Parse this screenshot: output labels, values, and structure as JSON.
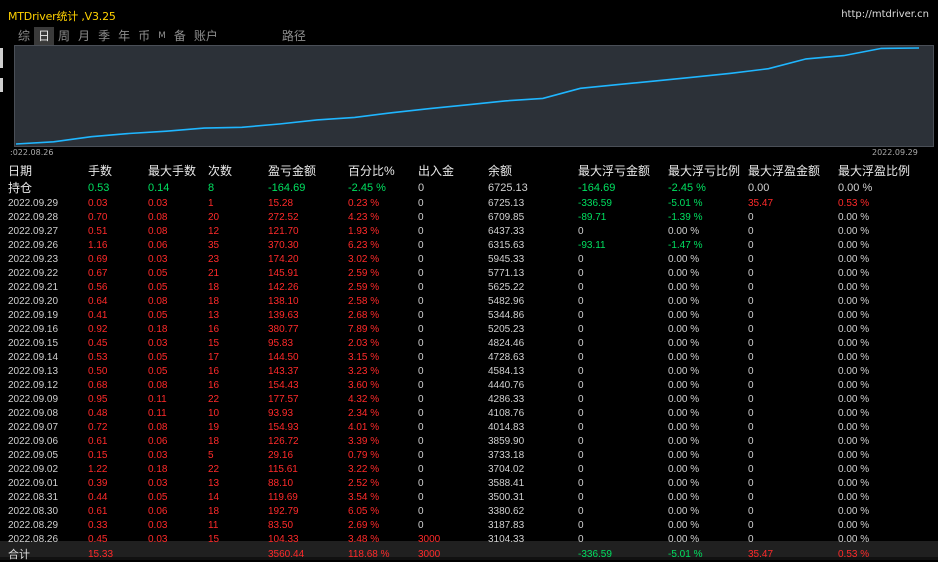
{
  "window": {
    "title": "MTDriver统计 ,V3.25",
    "url": "http://mtdriver.cn"
  },
  "tabs": [
    {
      "label": "综",
      "active": false
    },
    {
      "label": "日",
      "active": true
    },
    {
      "label": "周",
      "active": false
    },
    {
      "label": "月",
      "active": false
    },
    {
      "label": "季",
      "active": false
    },
    {
      "label": "年",
      "active": false
    },
    {
      "label": "币",
      "active": false
    },
    {
      "label": "M",
      "active": false
    },
    {
      "label": "备",
      "active": false
    },
    {
      "label": "账户",
      "active": false
    },
    {
      "label": "路径",
      "active": false
    }
  ],
  "chart_data": {
    "type": "line",
    "x_start_label": ":022.08.26",
    "x_end_label": "2022.09.29",
    "x": [
      "2022.08.26",
      "2022.08.29",
      "2022.08.30",
      "2022.08.31",
      "2022.09.01",
      "2022.09.02",
      "2022.09.05",
      "2022.09.06",
      "2022.09.07",
      "2022.09.08",
      "2022.09.09",
      "2022.09.12",
      "2022.09.13",
      "2022.09.14",
      "2022.09.15",
      "2022.09.16",
      "2022.09.19",
      "2022.09.20",
      "2022.09.21",
      "2022.09.22",
      "2022.09.23",
      "2022.09.26",
      "2022.09.27",
      "2022.09.28",
      "2022.09.29"
    ],
    "y": [
      3104.33,
      3187.83,
      3380.62,
      3500.31,
      3588.41,
      3704.02,
      3733.18,
      3859.9,
      4014.83,
      4108.76,
      4286.33,
      4440.76,
      4584.13,
      4728.63,
      4824.46,
      5205.23,
      5344.86,
      5482.96,
      5625.22,
      5771.13,
      5945.33,
      6315.63,
      6437.33,
      6709.85,
      6725.13
    ],
    "line_color": "#1fb6ff",
    "background": "#2c3138"
  },
  "table": {
    "headers": [
      "日期",
      "手数",
      "最大手数",
      "次数",
      "盈亏金额",
      "百分比%",
      "出入金",
      "余额",
      "最大浮亏金额",
      "最大浮亏比例",
      "最大浮盈金额",
      "最大浮盈比例"
    ],
    "holding": [
      "持仓",
      "0.53",
      "0.14",
      "8",
      "-164.69",
      "-2.45 %",
      "0",
      "6725.13",
      "-164.69",
      "-2.45 %",
      "0.00",
      "0.00 %"
    ],
    "rows": [
      [
        "2022.09.29",
        "0.03",
        "0.03",
        "1",
        "15.28",
        "0.23 %",
        "0",
        "6725.13",
        "-336.59",
        "-5.01 %",
        "35.47",
        "0.53 %"
      ],
      [
        "2022.09.28",
        "0.70",
        "0.08",
        "20",
        "272.52",
        "4.23 %",
        "0",
        "6709.85",
        "-89.71",
        "-1.39 %",
        "0",
        "0.00 %"
      ],
      [
        "2022.09.27",
        "0.51",
        "0.08",
        "12",
        "121.70",
        "1.93 %",
        "0",
        "6437.33",
        "0",
        "0.00 %",
        "0",
        "0.00 %"
      ],
      [
        "2022.09.26",
        "1.16",
        "0.06",
        "35",
        "370.30",
        "6.23 %",
        "0",
        "6315.63",
        "-93.11",
        "-1.47 %",
        "0",
        "0.00 %"
      ],
      [
        "2022.09.23",
        "0.69",
        "0.03",
        "23",
        "174.20",
        "3.02 %",
        "0",
        "5945.33",
        "0",
        "0.00 %",
        "0",
        "0.00 %"
      ],
      [
        "2022.09.22",
        "0.67",
        "0.05",
        "21",
        "145.91",
        "2.59 %",
        "0",
        "5771.13",
        "0",
        "0.00 %",
        "0",
        "0.00 %"
      ],
      [
        "2022.09.21",
        "0.56",
        "0.05",
        "18",
        "142.26",
        "2.59 %",
        "0",
        "5625.22",
        "0",
        "0.00 %",
        "0",
        "0.00 %"
      ],
      [
        "2022.09.20",
        "0.64",
        "0.08",
        "18",
        "138.10",
        "2.58 %",
        "0",
        "5482.96",
        "0",
        "0.00 %",
        "0",
        "0.00 %"
      ],
      [
        "2022.09.19",
        "0.41",
        "0.05",
        "13",
        "139.63",
        "2.68 %",
        "0",
        "5344.86",
        "0",
        "0.00 %",
        "0",
        "0.00 %"
      ],
      [
        "2022.09.16",
        "0.92",
        "0.18",
        "16",
        "380.77",
        "7.89 %",
        "0",
        "5205.23",
        "0",
        "0.00 %",
        "0",
        "0.00 %"
      ],
      [
        "2022.09.15",
        "0.45",
        "0.03",
        "15",
        "95.83",
        "2.03 %",
        "0",
        "4824.46",
        "0",
        "0.00 %",
        "0",
        "0.00 %"
      ],
      [
        "2022.09.14",
        "0.53",
        "0.05",
        "17",
        "144.50",
        "3.15 %",
        "0",
        "4728.63",
        "0",
        "0.00 %",
        "0",
        "0.00 %"
      ],
      [
        "2022.09.13",
        "0.50",
        "0.05",
        "16",
        "143.37",
        "3.23 %",
        "0",
        "4584.13",
        "0",
        "0.00 %",
        "0",
        "0.00 %"
      ],
      [
        "2022.09.12",
        "0.68",
        "0.08",
        "16",
        "154.43",
        "3.60 %",
        "0",
        "4440.76",
        "0",
        "0.00 %",
        "0",
        "0.00 %"
      ],
      [
        "2022.09.09",
        "0.95",
        "0.11",
        "22",
        "177.57",
        "4.32 %",
        "0",
        "4286.33",
        "0",
        "0.00 %",
        "0",
        "0.00 %"
      ],
      [
        "2022.09.08",
        "0.48",
        "0.11",
        "10",
        "93.93",
        "2.34 %",
        "0",
        "4108.76",
        "0",
        "0.00 %",
        "0",
        "0.00 %"
      ],
      [
        "2022.09.07",
        "0.72",
        "0.08",
        "19",
        "154.93",
        "4.01 %",
        "0",
        "4014.83",
        "0",
        "0.00 %",
        "0",
        "0.00 %"
      ],
      [
        "2022.09.06",
        "0.61",
        "0.06",
        "18",
        "126.72",
        "3.39 %",
        "0",
        "3859.90",
        "0",
        "0.00 %",
        "0",
        "0.00 %"
      ],
      [
        "2022.09.05",
        "0.15",
        "0.03",
        "5",
        "29.16",
        "0.79 %",
        "0",
        "3733.18",
        "0",
        "0.00 %",
        "0",
        "0.00 %"
      ],
      [
        "2022.09.02",
        "1.22",
        "0.18",
        "22",
        "115.61",
        "3.22 %",
        "0",
        "3704.02",
        "0",
        "0.00 %",
        "0",
        "0.00 %"
      ],
      [
        "2022.09.01",
        "0.39",
        "0.03",
        "13",
        "88.10",
        "2.52 %",
        "0",
        "3588.41",
        "0",
        "0.00 %",
        "0",
        "0.00 %"
      ],
      [
        "2022.08.31",
        "0.44",
        "0.05",
        "14",
        "119.69",
        "3.54 %",
        "0",
        "3500.31",
        "0",
        "0.00 %",
        "0",
        "0.00 %"
      ],
      [
        "2022.08.30",
        "0.61",
        "0.06",
        "18",
        "192.79",
        "6.05 %",
        "0",
        "3380.62",
        "0",
        "0.00 %",
        "0",
        "0.00 %"
      ],
      [
        "2022.08.29",
        "0.33",
        "0.03",
        "11",
        "83.50",
        "2.69 %",
        "0",
        "3187.83",
        "0",
        "0.00 %",
        "0",
        "0.00 %"
      ],
      [
        "2022.08.26",
        "0.45",
        "0.03",
        "15",
        "104.33",
        "3.48 %",
        "3000",
        "3104.33",
        "0",
        "0.00 %",
        "0",
        "0.00 %"
      ]
    ],
    "total": [
      "合计",
      "15.33",
      "",
      "",
      "3560.44",
      "118.68 %",
      "3000",
      "",
      "-336.59",
      "-5.01 %",
      "35.47",
      "0.53 %"
    ]
  }
}
